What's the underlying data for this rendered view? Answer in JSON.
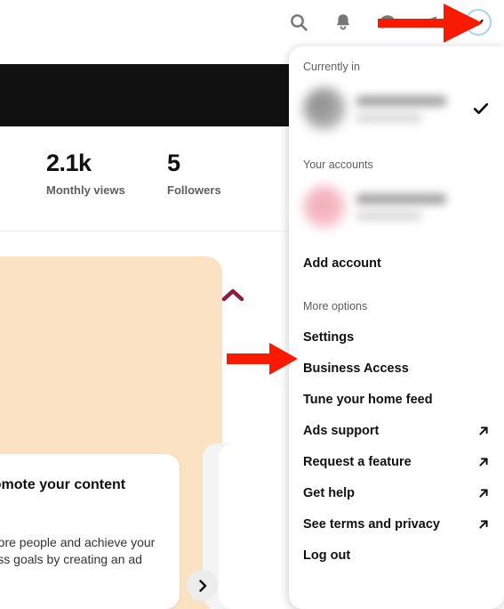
{
  "topbar": {
    "icons": [
      {
        "name": "search-icon",
        "label": "Search"
      },
      {
        "name": "bell-icon",
        "label": "Notifications"
      },
      {
        "name": "message-bubble-icon",
        "label": "Messages"
      },
      {
        "name": "megaphone-icon",
        "label": "Ads"
      }
    ],
    "account_switcher": {
      "name": "chevron-down-icon",
      "label": "Account menu",
      "ring_color": "#a8d3f0"
    }
  },
  "profile_stats": [
    {
      "value": "2.1k",
      "label": "Monthly views"
    },
    {
      "value": "5",
      "label": "Followers"
    }
  ],
  "promo_card": {
    "collapse_icon": "chevron-up-icon",
    "collapse_icon_color": "#8c1d3f",
    "title": "Promote your content",
    "body": "Reach more people and achieve your business goals by creating an ad",
    "next_label": "Next"
  },
  "menu": {
    "currently_in_label": "Currently in",
    "current_account": {
      "redacted": true,
      "checked": true,
      "check_icon": "check-icon",
      "avatar_color": "#adadad"
    },
    "your_accounts_label": "Your accounts",
    "other_accounts": [
      {
        "redacted": true,
        "avatar_color": "#f3a8b6"
      }
    ],
    "add_account_label": "Add account",
    "more_options_label": "More options",
    "options": [
      {
        "label": "Settings",
        "external": false
      },
      {
        "label": "Business Access",
        "external": false
      },
      {
        "label": "Tune your home feed",
        "external": false
      },
      {
        "label": "Ads support",
        "external": true
      },
      {
        "label": "Request a feature",
        "external": true
      },
      {
        "label": "Get help",
        "external": true
      },
      {
        "label": "See terms and privacy",
        "external": true
      },
      {
        "label": "Log out",
        "external": false
      }
    ],
    "external_icon": "external-link-arrow-icon"
  },
  "annotations": {
    "color": "#f81b02",
    "arrows": [
      {
        "name": "arrow-to-account-switcher",
        "points_to": "chevron-down-icon"
      },
      {
        "name": "arrow-to-settings",
        "points_to": "Settings"
      }
    ]
  }
}
